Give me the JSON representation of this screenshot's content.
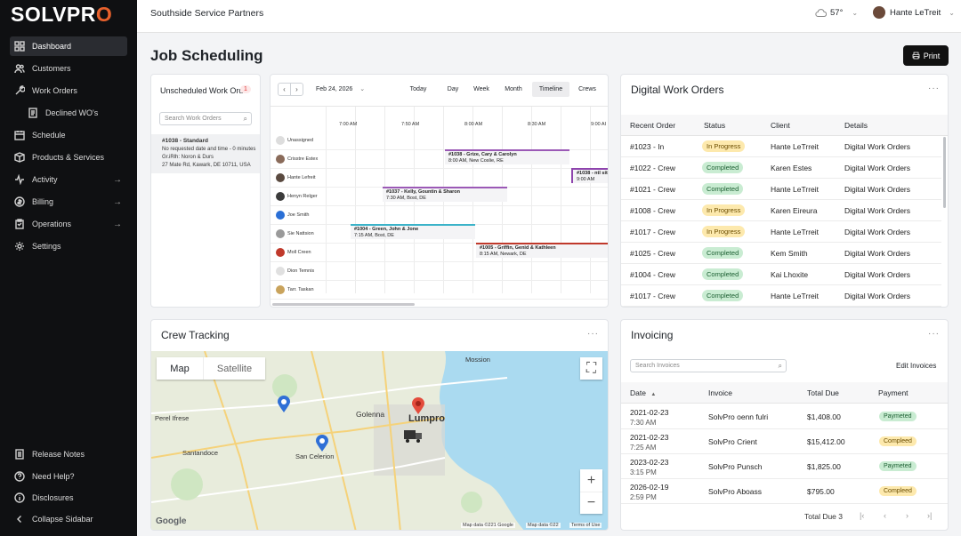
{
  "brand": {
    "logo_pre": "SOLVPR",
    "logo_o": "O"
  },
  "sidebar": {
    "items": [
      {
        "label": "Dashboard",
        "icon": "grid-icon",
        "active": true
      },
      {
        "label": "Customers",
        "icon": "users-icon"
      },
      {
        "label": "Work Orders",
        "icon": "wrench-icon"
      },
      {
        "label": "Declined WO's",
        "icon": "document-icon"
      },
      {
        "label": "Schedule",
        "icon": "calendar-icon"
      },
      {
        "label": "Products & Services",
        "icon": "box-icon"
      },
      {
        "label": "Activity",
        "icon": "activity-icon"
      },
      {
        "label": "Billing",
        "icon": "card-icon"
      },
      {
        "label": "Operations",
        "icon": "clipboard-icon"
      },
      {
        "label": "Settings",
        "icon": "gear-icon"
      }
    ],
    "bottom": [
      {
        "label": "Release Notes",
        "icon": "notes-icon"
      },
      {
        "label": "Need Help?",
        "icon": "help-icon"
      },
      {
        "label": "Disclosures",
        "icon": "info-icon"
      },
      {
        "label": "Collapse Sidabar",
        "icon": "chevron-left-icon"
      }
    ]
  },
  "topbar": {
    "company": "Southside Service Partners",
    "temperature": "57°",
    "user_name": "Hante LeTreit"
  },
  "page": {
    "title": "Job Scheduling",
    "print_label": "Print"
  },
  "unscheduled": {
    "title": "Unscheduled Work Orde",
    "count": "1",
    "search_placeholder": "Search Work Orders",
    "item": {
      "title": "#1038 - Standard",
      "line1": "No requested date and time - 0 minutes",
      "line2": "Gr.iRlh: Noron & Durs",
      "line3": "27 Mate Rd, Kawark, DE 10711, USA"
    }
  },
  "timeline": {
    "date": "Feb 24, 2026",
    "views": [
      "Today",
      "Day",
      "Week",
      "Month",
      "Timeline",
      "Crews"
    ],
    "active_view": "Timeline",
    "times": [
      "7:00 AM",
      "7:50 AM",
      "8:00 AM",
      "8:30 AM",
      "9:00 AI"
    ],
    "crews": [
      "Unassigned",
      "Crisstre Estex",
      "Hante Lefreit",
      "Henyn Relger",
      "Joe Smith",
      "Sie Nattsion",
      "Moll Creen",
      "Dion Temnis",
      "Tarr. Taskan"
    ],
    "jobs": [
      {
        "title": "#1038 - Grize, Cary & Carolyn",
        "sub": "8:00 AM, New Coslie, RE"
      },
      {
        "title": "#1038 - ntl sit",
        "sub": "9:00 AM"
      },
      {
        "title": "#1037 - Kelly, Gountin & Sharon",
        "sub": "7:30 AM, Bost, DE"
      },
      {
        "title": "#1004 - Green, John & Jone",
        "sub": "7:15 AM, Bost, DE"
      },
      {
        "title": "#1005 - Griffin, Genid & Kathleen",
        "sub": "8:15 AM, Newark, DE"
      }
    ]
  },
  "digital_work_orders": {
    "title": "Digital Work Orders",
    "headers": [
      "Recent Order",
      "Status",
      "Client",
      "Details"
    ],
    "rows": [
      {
        "order": "#1023 - In",
        "status": "In Progress",
        "client": "Hante LeTrreit",
        "details": "Digital Work Orders"
      },
      {
        "order": "#1022 - Crew",
        "status": "Completed",
        "client": "Karen Estes",
        "details": "Digital Work Orders"
      },
      {
        "order": "#1021 - Crew",
        "status": "Completed",
        "client": "Hante LeTrreit",
        "details": "Digital Work Orders"
      },
      {
        "order": "#1008 - Crew",
        "status": "In Progress",
        "client": "Karen Eireura",
        "details": "Digital Work Orders"
      },
      {
        "order": "#1017 - Crew",
        "status": "In Progress",
        "client": "Hante LeTrreit",
        "details": "Digital Work Orders"
      },
      {
        "order": "#1025 - Crew",
        "status": "Completed",
        "client": "Kem Smith",
        "details": "Digital Work Orders"
      },
      {
        "order": "#1004 - Crew",
        "status": "Completed",
        "client": "Kai Lhoxite",
        "details": "Digital Work Orders"
      },
      {
        "order": "#1017 - Crew",
        "status": "Completed",
        "client": "Hante LeTrreit",
        "details": "Digital Work Orders"
      }
    ]
  },
  "crew_tracking": {
    "title": "Crew Tracking",
    "map_tab": "Map",
    "satellite_tab": "Satellite",
    "labels": [
      "Mossion",
      "Golenna",
      "Lumpro",
      "Perel Ifrese",
      "Santandoce",
      "San Celerion"
    ],
    "attribution": [
      "Map data ©221 Google",
      "Map data ©22",
      "Terms of Use"
    ],
    "google": "Google"
  },
  "invoicing": {
    "title": "Invoicing",
    "search_placeholder": "Search Invoices",
    "edit_label": "Edit Invoices",
    "headers": [
      "Date",
      "Invoice",
      "Total Due",
      "Payment"
    ],
    "rows": [
      {
        "date": "2021-02-23",
        "time": "7:30 AM",
        "invoice": "SolvPro oenn fulri",
        "total": "$1,408.00",
        "payment": "Paymeted"
      },
      {
        "date": "2021-02-23",
        "time": "7:25 AM",
        "invoice": "SolvPro Crient",
        "total": "$15,412.00",
        "payment": "Compleed"
      },
      {
        "date": "2023-02-23",
        "time": "3:15 PM",
        "invoice": "SolvPro Punsch",
        "total": "$1,825.00",
        "payment": "Paymeted"
      },
      {
        "date": "2026-02-19",
        "time": "2:59 PM",
        "invoice": "SolvPro Aboass",
        "total": "$795.00",
        "payment": "Compleed"
      }
    ],
    "total_due_label": "Total Due 3"
  }
}
